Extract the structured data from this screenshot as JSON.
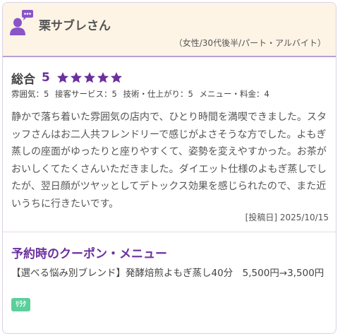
{
  "reviewer": {
    "name": "栗サブレさん",
    "meta": "（女性/30代後半/パート・アルバイト）",
    "avatar_icon": "user-comment-icon"
  },
  "rating": {
    "overall_label": "総合",
    "overall_score": "5",
    "stars": 5,
    "star_color": "#6b2f9e",
    "sub_ratings": [
      "雰囲気：5",
      "接客サービス：5",
      "技術・仕上がり：5",
      "メニュー・料金：4"
    ]
  },
  "review": {
    "text": "静かで落ち着いた雰囲気の店内で、ひとり時間を満喫できました。スタッフさんはお二人共フレンドリーで感じがよさそうな方でした。よもぎ蒸しの座面がゆったりと座りやすくて、姿勢を変えやすかった。お茶がおいしくてたくさんいただきました。ダイエット仕様のよもぎ蒸しでしたが、翌日顔がツヤッとしてデトックス効果を感じられたので、また近いうちに行きたいです。",
    "post_date": "[投稿日] 2025/10/15"
  },
  "coupon": {
    "title": "予約時のクーポン・メニュー",
    "text": "【選べる悩み別ブレンド】発酵焙煎よもぎ蒸し40分　5,500円→3,500円",
    "tag": "ﾘﾗｸ",
    "tag_color": "#5ccf9a"
  },
  "colors": {
    "accent": "#6b2f9e",
    "header_bg": "#fdf4e6",
    "header_border": "#b8a0d6"
  }
}
